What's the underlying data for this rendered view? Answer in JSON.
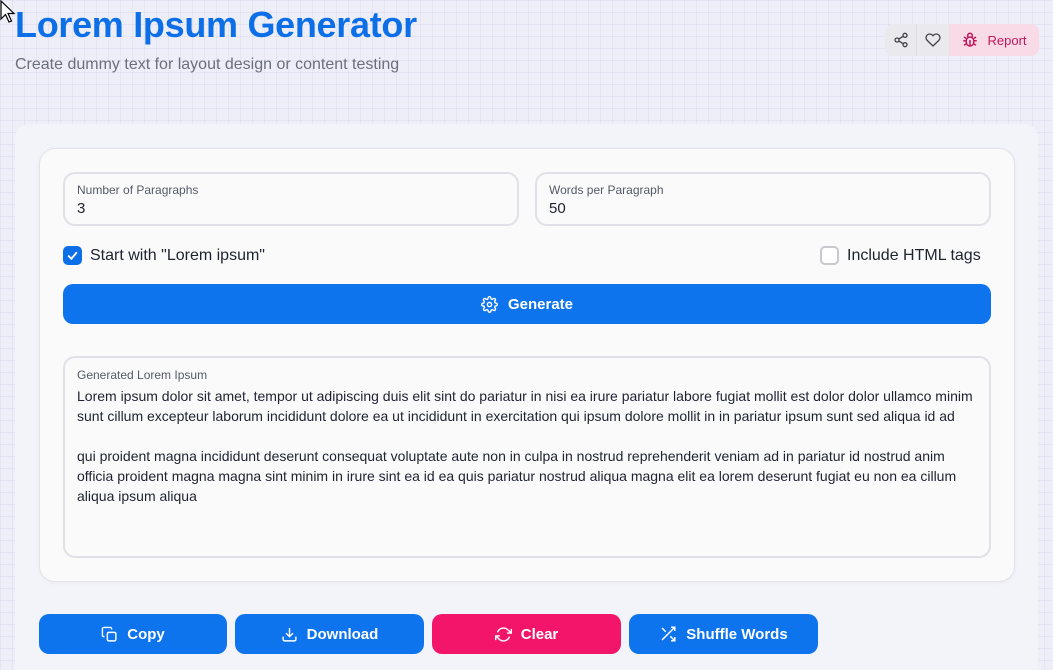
{
  "header": {
    "title": "Lorem Ipsum Generator",
    "subtitle": "Create dummy text for layout design or content testing"
  },
  "top_actions": {
    "share_icon": "share-icon",
    "favorite_icon": "heart-icon",
    "report_icon": "bug-icon",
    "report_label": "Report"
  },
  "form": {
    "paragraphs_label": "Number of Paragraphs",
    "paragraphs_value": "3",
    "words_label": "Words per Paragraph",
    "words_value": "50",
    "start_lorem_label": "Start with \"Lorem ipsum\"",
    "start_lorem_checked": true,
    "html_tags_label": "Include HTML tags",
    "html_tags_checked": false,
    "generate_label": "Generate"
  },
  "output": {
    "label": "Generated Lorem Ipsum",
    "text": "Lorem ipsum dolor sit amet, tempor ut adipiscing duis elit sint do pariatur in nisi ea irure pariatur labore fugiat mollit est dolor dolor ullamco minim sunt cillum excepteur laborum incididunt dolore ea ut incididunt in exercitation qui ipsum dolore mollit in in pariatur ipsum sunt sed aliqua id ad\n\nqui proident magna incididunt deserunt consequat voluptate aute non in culpa in nostrud reprehenderit veniam ad in pariatur id nostrud anim officia proident magna magna sint minim in irure sint ea id ea quis pariatur nostrud aliqua magna elit ea lorem deserunt fugiat eu non ea cillum aliqua ipsum aliqua"
  },
  "actions": {
    "copy_label": "Copy",
    "download_label": "Download",
    "clear_label": "Clear",
    "shuffle_label": "Shuffle Words"
  },
  "colors": {
    "primary": "#0d74ee",
    "title": "#0d6fe8",
    "danger": "#f2156a",
    "report_bg": "#f9dbe7",
    "report_text": "#c2185b"
  }
}
